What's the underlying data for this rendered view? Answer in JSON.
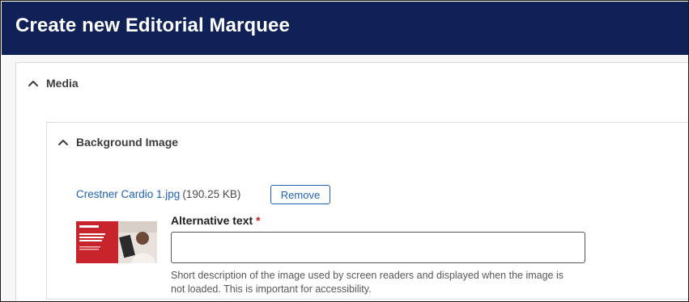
{
  "page": {
    "title": "Create new Editorial Marquee"
  },
  "media_section": {
    "label": "Media"
  },
  "background_image": {
    "label": "Background Image",
    "file_name": "Crestner Cardio 1.jpg",
    "file_size": "(190.25 KB)",
    "remove_label": "Remove",
    "thumbnail": {
      "brand": "crestner",
      "headline": "Early Detection. Lifelong Protection.",
      "colors": {
        "background": "#c8242b",
        "photo": "#e9e2dc"
      }
    },
    "alt_text": {
      "label": "Alternative text",
      "required_marker": "*",
      "value": "",
      "description": "Short description of the image used by screen readers and displayed when the im­age is not loaded. This is important for accessibility."
    }
  },
  "icons": {
    "media_toggle": "chevron-up-icon",
    "background_toggle": "chevron-up-icon"
  },
  "colors": {
    "header_bg": "#0f2156",
    "link": "#1e60b8",
    "required": "#cc1f1f"
  }
}
